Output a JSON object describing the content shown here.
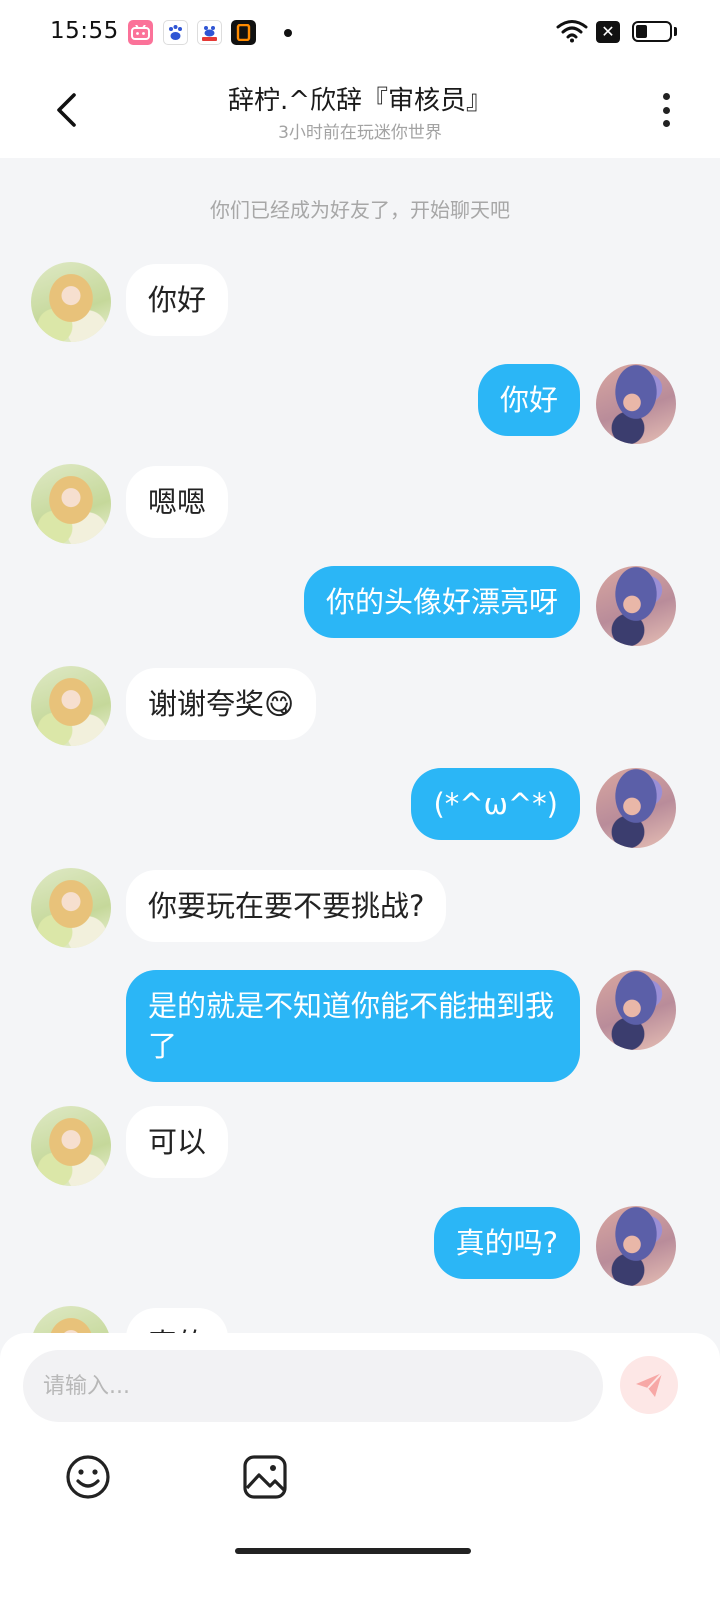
{
  "status_bar": {
    "time": "15:55",
    "apps": [
      {
        "icon": "bilibili-icon",
        "color": "#fb7299"
      },
      {
        "icon": "baidu-icon",
        "color": "#ffffff"
      },
      {
        "icon": "baidu-tieba-icon",
        "color": "#ffffff"
      },
      {
        "icon": "app-icon",
        "color": "#111111"
      }
    ],
    "battery_level": 0.35
  },
  "header": {
    "title": "辞柠.^欣辞『审核员』",
    "subtitle": "3小时前在玩迷你世界",
    "back_icon": "chevron-left-icon",
    "more_icon": "more-vertical-icon"
  },
  "chat": {
    "system_message": "你们已经成为好友了，开始聊天吧",
    "messages": [
      {
        "side": "left",
        "text": "你好"
      },
      {
        "side": "right",
        "text": "你好"
      },
      {
        "side": "left",
        "text": "嗯嗯"
      },
      {
        "side": "right",
        "text": "你的头像好漂亮呀"
      },
      {
        "side": "left",
        "text": "谢谢夸奖😋"
      },
      {
        "side": "right",
        "text": "(*^ω^*)"
      },
      {
        "side": "left",
        "text": "你要玩在要不要挑战?"
      },
      {
        "side": "right",
        "text": "是的就是不知道你能不能抽到我了"
      },
      {
        "side": "left",
        "text": "可以"
      },
      {
        "side": "right",
        "text": "真的吗?"
      },
      {
        "side": "left",
        "text": "真的"
      }
    ]
  },
  "composer": {
    "placeholder": "请输入...",
    "send_icon": "send-icon",
    "tools": [
      {
        "icon": "emoji-icon"
      },
      {
        "icon": "image-icon"
      }
    ]
  },
  "colors": {
    "accent": "#2bb6f6",
    "background": "#f4f5f7",
    "send_button_bg": "#fde7e6",
    "send_button_fg": "#f7a8a6"
  }
}
